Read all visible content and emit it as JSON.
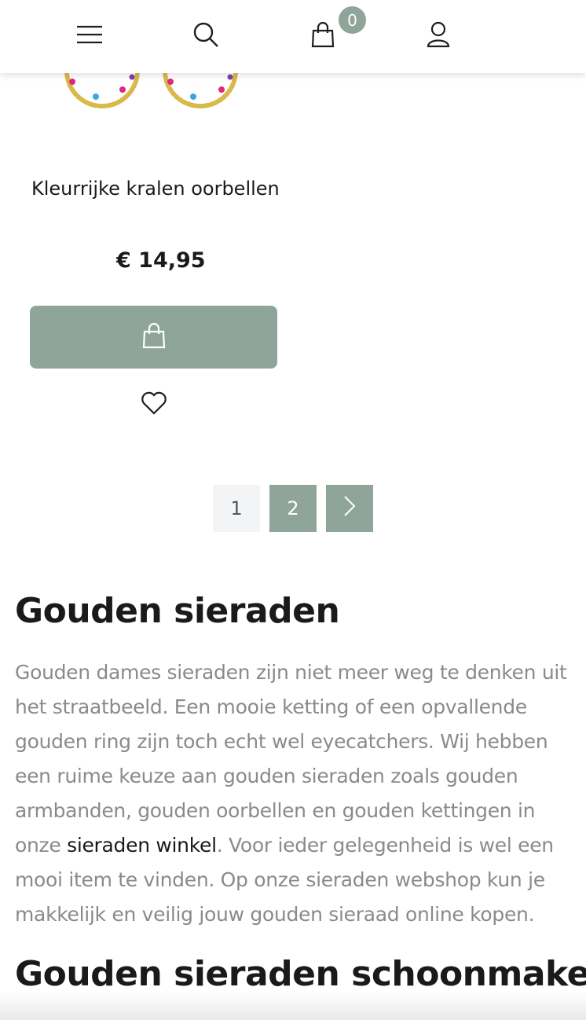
{
  "header": {
    "menu_icon": "hamburger-menu-icon",
    "search_icon": "search-icon",
    "cart_icon": "shopping-bag-icon",
    "cart_count": "0",
    "account_icon": "user-icon",
    "accent_color": "#8fa599"
  },
  "product": {
    "title": "Kleurrijke kralen oorbellen",
    "price": "€ 14,95",
    "add_to_cart_icon": "shopping-bag-icon",
    "wishlist_icon": "heart-icon"
  },
  "pagination": {
    "pages": [
      "1",
      "2"
    ],
    "current": "2",
    "next_icon": "chevron-right-icon"
  },
  "content": {
    "heading_1": "Gouden sieraden",
    "paragraph_before_link": "Gouden dames sieraden zijn niet meer weg te denken uit het straatbeeld. Een mooie ketting of een opvallende gouden ring zijn toch echt wel eyecatchers. Wij hebben een ruime keuze aan gouden sieraden zoals gouden armbanden, gouden oorbellen en gouden kettingen in onze ",
    "link_text": "sieraden winkel",
    "paragraph_after_link": ". Voor ieder gelegenheid is wel een mooi item te vinden. Op onze sieraden webshop kun je makkelijk en veilig jouw gouden sieraad online kopen.",
    "heading_2": "Gouden sieraden schoonmaken"
  }
}
